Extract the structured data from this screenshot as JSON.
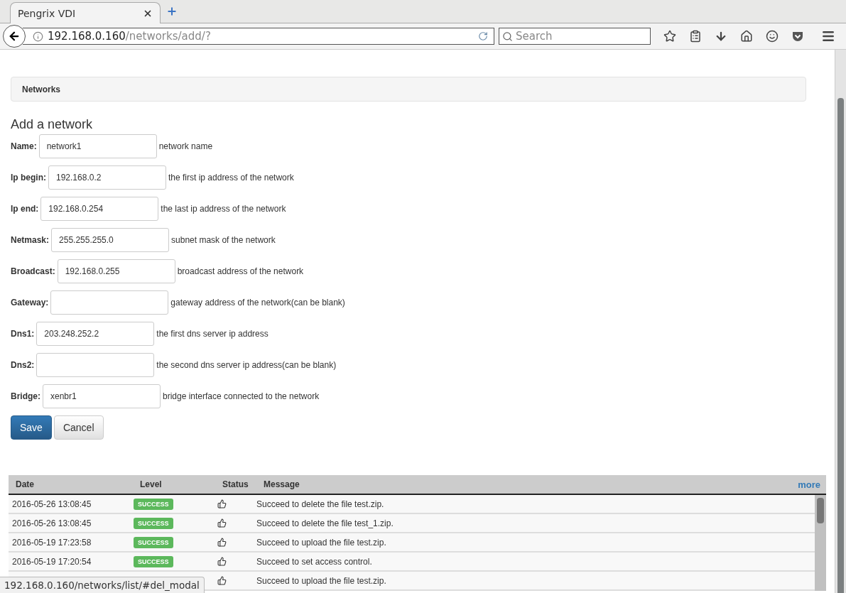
{
  "browser": {
    "tab": {
      "title": "Pengrix VDI",
      "selected": true
    },
    "address": {
      "host": "192.168.0.160",
      "path": "/networks/add/?"
    },
    "search": {
      "placeholder": "Search"
    }
  },
  "breadcrumb": "Networks",
  "form": {
    "title": "Add a network",
    "fields": [
      {
        "label": "Name:",
        "value": "network1",
        "hint": "network name"
      },
      {
        "label": "Ip begin:",
        "value": "192.168.0.2",
        "hint": "the first ip address of the network"
      },
      {
        "label": "Ip end:",
        "value": "192.168.0.254",
        "hint": "the last ip address of the network"
      },
      {
        "label": "Netmask:",
        "value": "255.255.255.0",
        "hint": "subnet mask of the network"
      },
      {
        "label": "Broadcast:",
        "value": "192.168.0.255",
        "hint": "broadcast address of the network"
      },
      {
        "label": "Gateway:",
        "hint": "gateway address of the network(can be blank)"
      },
      {
        "label": "Dns1:",
        "value": "203.248.252.2",
        "hint": "the first dns server ip address"
      },
      {
        "label": "Dns2:",
        "hint": "the second dns server ip address(can be blank)"
      },
      {
        "label": "Bridge:",
        "value": "xenbr1",
        "hint": "bridge interface connected to the network"
      }
    ],
    "buttons": [
      {
        "label": "Save",
        "kind": "primary"
      },
      {
        "label": "Cancel",
        "kind": "default"
      }
    ]
  },
  "log": {
    "columns": [
      "Date",
      "Level",
      "Status",
      "Message"
    ],
    "more": "more",
    "rows": [
      {
        "date": "2016-05-26 13:08:45",
        "level": "SUCCESS",
        "message": "Succeed to delete the file test.zip."
      },
      {
        "date": "2016-05-26 13:08:45",
        "level": "SUCCESS",
        "message": "Succeed to delete the file test_1.zip."
      },
      {
        "date": "2016-05-19 17:23:58",
        "level": "SUCCESS",
        "message": "Succeed to upload the file test.zip."
      },
      {
        "date": "2016-05-19 17:20:54",
        "level": "SUCCESS",
        "message": "Succeed to set access control."
      },
      {
        "message": "Succeed to upload the file test.zip."
      }
    ]
  },
  "status_url": "192.168.0.160/networks/list/#del_modal"
}
